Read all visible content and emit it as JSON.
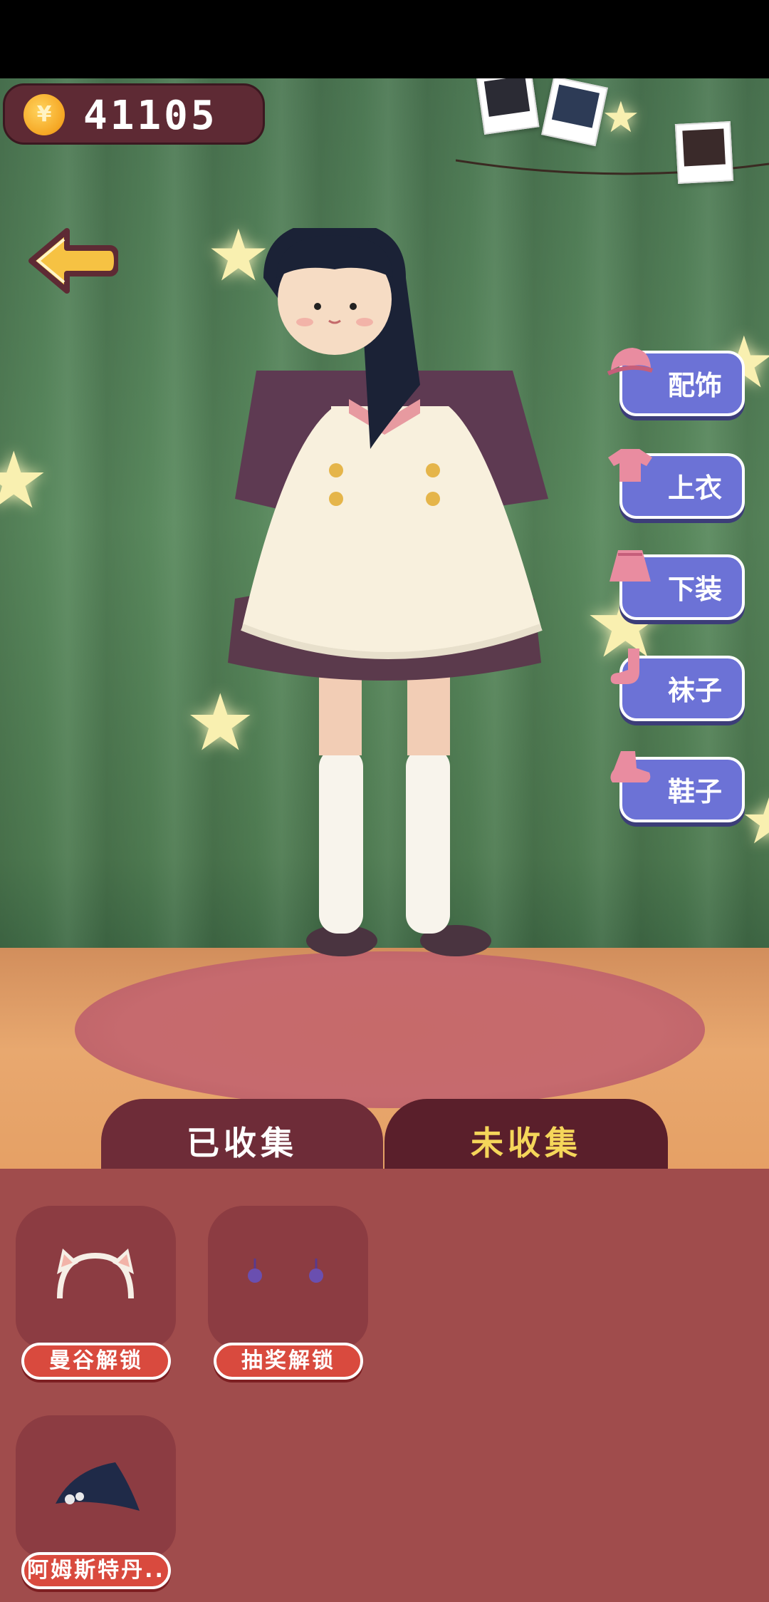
{
  "coins": {
    "value": "41105",
    "icon": "coin-icon"
  },
  "categories": [
    {
      "label": "配饰",
      "icon": "hat-icon"
    },
    {
      "label": "上衣",
      "icon": "shirt-icon"
    },
    {
      "label": "下装",
      "icon": "skirt-icon"
    },
    {
      "label": "袜子",
      "icon": "sock-icon"
    },
    {
      "label": "鞋子",
      "icon": "shoe-icon"
    }
  ],
  "tabs": [
    {
      "label": "已收集",
      "selected": false
    },
    {
      "label": "未收集",
      "selected": true
    }
  ],
  "items": [
    {
      "button": "曼谷解锁",
      "icon": "cat-ear-headband-icon"
    },
    {
      "button": "抽奖解锁",
      "icon": "earrings-icon"
    },
    {
      "button": "阿姆斯特丹..",
      "icon": "beret-icon"
    }
  ],
  "colors": {
    "accent_tab": "#f5d65a",
    "button_red": "#d94a3e",
    "category_blue": "#6c72d6",
    "panel": "#a04c4c"
  }
}
